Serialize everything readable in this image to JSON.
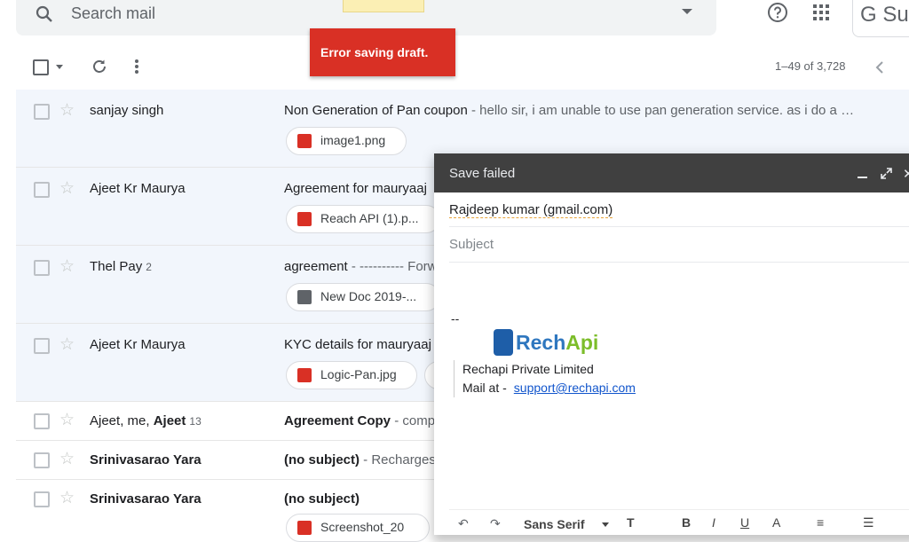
{
  "search": {
    "placeholder": "Search mail"
  },
  "toasts": {
    "error": "Error saving draft."
  },
  "header": {
    "suite_label": "G Su"
  },
  "toolbar": {
    "pagination": "1–49 of 3,728"
  },
  "emails": [
    {
      "sender": "sanjay singh",
      "count": "",
      "subject": "Non Generation of Pan coupon",
      "snippet": " - hello sir, i am unable to use pan generation service. as i do a …",
      "attachment": "image1.png",
      "attachment_type": "image"
    },
    {
      "sender": "Ajeet Kr Maurya",
      "count": "",
      "subject": "Agreement for mauryaaj",
      "snippet": "",
      "attachment": "Reach API (1).p...",
      "attachment_type": "pdf"
    },
    {
      "sender": "Thel Pay",
      "count": "2",
      "subject": "agreement",
      "snippet": " - ---------- Forw",
      "attachment": "New Doc 2019-...",
      "attachment_type": "doc"
    },
    {
      "sender": "Ajeet Kr Maurya",
      "count": "",
      "subject": "KYC details for mauryaaj",
      "snippet": "",
      "attachment": "Logic-Pan.jpg",
      "attachment_type": "image"
    },
    {
      "sender_plain": "Ajeet, me, ",
      "sender_bold": "Ajeet",
      "count": "13",
      "subject": "Agreement Copy",
      "snippet": " - comp"
    },
    {
      "sender": "Srinivasarao Yara",
      "count": "",
      "subject": "(no subject)",
      "snippet": " - Recharges"
    },
    {
      "sender": "Srinivasarao Yara",
      "count": "",
      "subject": "(no subject)",
      "snippet": "",
      "attachment": "Screenshot_20",
      "attachment_type": "image"
    }
  ],
  "compose": {
    "title": "Save failed",
    "to": "Rajdeep kumar (gmail.com)",
    "subject_placeholder": "Subject",
    "signature": {
      "dash": "--",
      "logo_part1": "Rech",
      "logo_part2": "Api",
      "company": "Rechapi Private Limited",
      "mail_label": "Mail at -",
      "email": "support@rechapi.com"
    },
    "format_toolbar": {
      "font": "Sans Serif"
    }
  },
  "colors": {
    "error_toast": "#d93025",
    "compose_bar": "#404040",
    "row_read": "#f2f6fc",
    "link": "#1155cc"
  }
}
